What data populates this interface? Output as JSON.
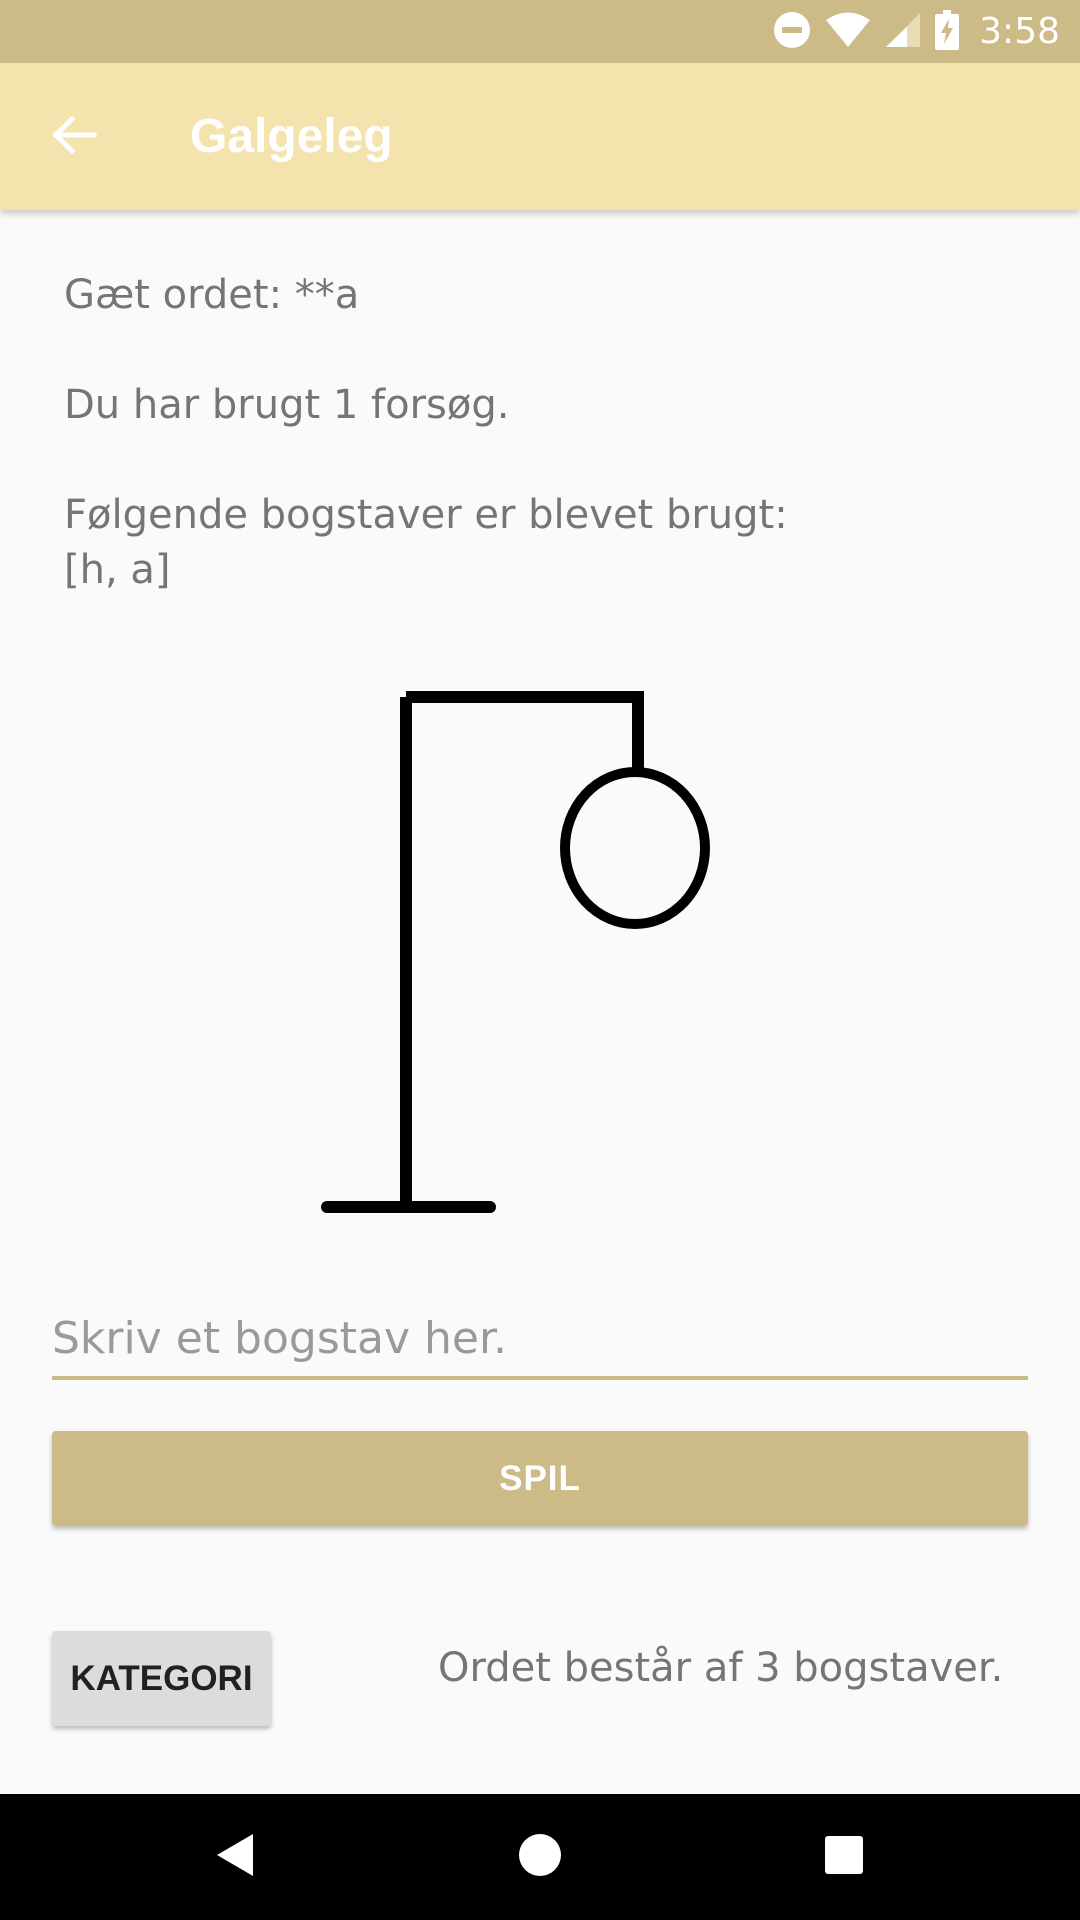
{
  "status_bar": {
    "time": "3:58",
    "icons": [
      "do-not-disturb-icon",
      "wifi-icon",
      "signal-icon",
      "battery-charging-icon"
    ]
  },
  "app_bar": {
    "title": "Galgeleg",
    "back_icon": "arrow-back-icon"
  },
  "game": {
    "guess_word": "Gæt ordet: **a",
    "attempts": "Du har brugt 1 forsøg.",
    "used_letters_label": "Følgende bogstaver er blevet brugt:",
    "used_letters": "[h, a]",
    "wrong_guesses": 1,
    "word_length_text": "Ordet består af 3 bogstaver."
  },
  "input": {
    "placeholder": "Skriv et bogstav her.",
    "value": ""
  },
  "buttons": {
    "play_label": "SPIL",
    "category_label": "KATEGORI"
  },
  "nav_bar": {
    "icons": [
      "back-triangle-icon",
      "home-circle-icon",
      "recents-square-icon"
    ]
  },
  "colors": {
    "status_bar": "#ccbb86",
    "app_bar": "#f4e3ad",
    "accent": "#ccbb86"
  }
}
